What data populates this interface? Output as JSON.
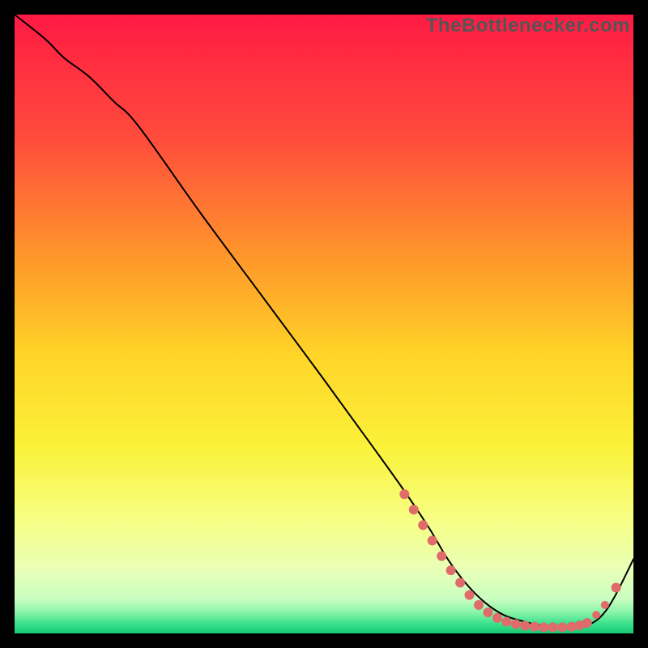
{
  "watermark": "TheBottlenecker.com",
  "colors": {
    "black": "#000000",
    "curve": "#000000",
    "dot_fill": "#e06b6b",
    "dot_fill_alt": "#de6666",
    "gradient_stops": [
      {
        "pos": 0.0,
        "color": "#ff1a44"
      },
      {
        "pos": 0.2,
        "color": "#ff4c3c"
      },
      {
        "pos": 0.4,
        "color": "#ff9a2a"
      },
      {
        "pos": 0.55,
        "color": "#ffd428"
      },
      {
        "pos": 0.7,
        "color": "#fbf23a"
      },
      {
        "pos": 0.82,
        "color": "#f6ff86"
      },
      {
        "pos": 0.9,
        "color": "#e8ffb8"
      },
      {
        "pos": 0.945,
        "color": "#c8ffc0"
      },
      {
        "pos": 0.965,
        "color": "#8cf5a8"
      },
      {
        "pos": 0.985,
        "color": "#38e08c"
      },
      {
        "pos": 1.0,
        "color": "#18c872"
      }
    ]
  },
  "chart_data": {
    "type": "line",
    "title": "",
    "xlabel": "",
    "ylabel": "",
    "xlim": [
      0,
      100
    ],
    "ylim": [
      0,
      100
    ],
    "series": [
      {
        "name": "bottleneck-curve",
        "x": [
          0,
          5,
          8,
          12,
          16,
          20,
          30,
          40,
          50,
          58,
          63,
          67,
          70,
          73,
          76,
          79,
          82,
          85,
          88,
          91,
          93,
          95,
          97,
          100
        ],
        "y": [
          100,
          96,
          93,
          90,
          86,
          82,
          68,
          54.5,
          41,
          30,
          23,
          17,
          12,
          8,
          5,
          3,
          2,
          1.3,
          1.0,
          1.0,
          1.5,
          3,
          6,
          12
        ]
      }
    ],
    "dot_cluster": {
      "name": "highlighted-range",
      "points": [
        {
          "x": 63.0,
          "y": 22.5,
          "r": 6
        },
        {
          "x": 64.5,
          "y": 20.0,
          "r": 6
        },
        {
          "x": 66.0,
          "y": 17.5,
          "r": 6
        },
        {
          "x": 67.5,
          "y": 15.0,
          "r": 6
        },
        {
          "x": 69.0,
          "y": 12.5,
          "r": 6
        },
        {
          "x": 70.5,
          "y": 10.2,
          "r": 6
        },
        {
          "x": 72.0,
          "y": 8.2,
          "r": 6
        },
        {
          "x": 73.5,
          "y": 6.2,
          "r": 6
        },
        {
          "x": 75.0,
          "y": 4.6,
          "r": 6
        },
        {
          "x": 76.5,
          "y": 3.4,
          "r": 6
        },
        {
          "x": 78.0,
          "y": 2.5,
          "r": 6
        },
        {
          "x": 79.5,
          "y": 1.9,
          "r": 6
        },
        {
          "x": 81.0,
          "y": 1.5,
          "r": 6
        },
        {
          "x": 82.5,
          "y": 1.25,
          "r": 6
        },
        {
          "x": 84.0,
          "y": 1.1,
          "r": 6
        },
        {
          "x": 85.5,
          "y": 1.0,
          "r": 6
        },
        {
          "x": 87.0,
          "y": 1.0,
          "r": 6
        },
        {
          "x": 88.5,
          "y": 1.0,
          "r": 6
        },
        {
          "x": 90.0,
          "y": 1.1,
          "r": 6
        },
        {
          "x": 91.3,
          "y": 1.3,
          "r": 6
        },
        {
          "x": 92.5,
          "y": 1.7,
          "r": 6
        },
        {
          "x": 94.0,
          "y": 3.0,
          "r": 5
        },
        {
          "x": 95.4,
          "y": 4.6,
          "r": 5
        },
        {
          "x": 97.2,
          "y": 7.4,
          "r": 6
        }
      ]
    }
  }
}
